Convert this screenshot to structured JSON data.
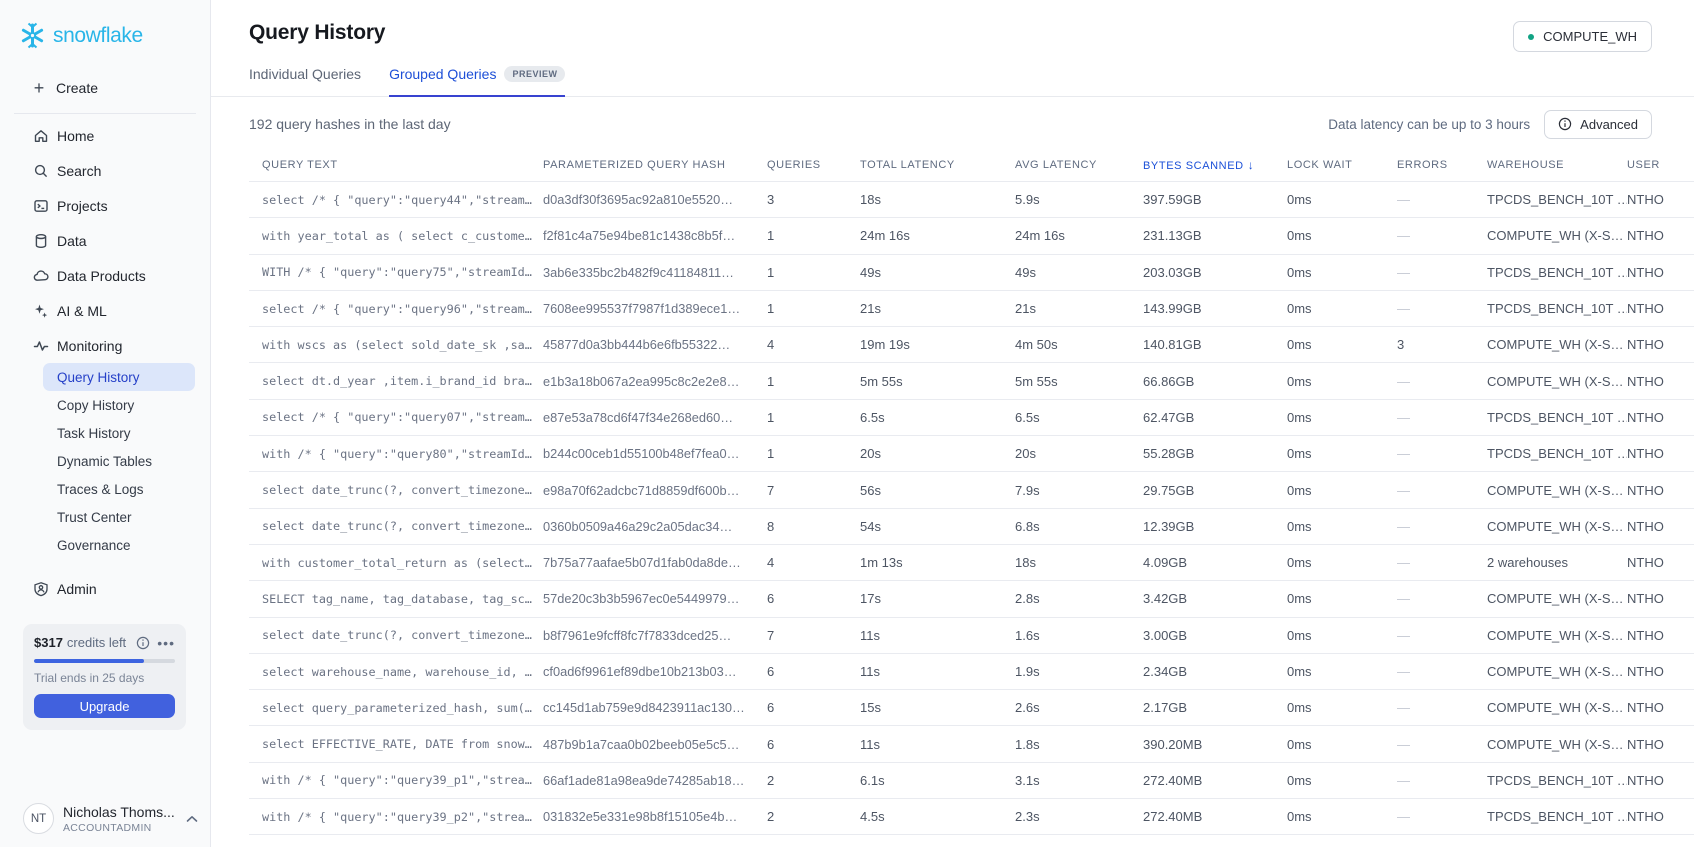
{
  "brand": {
    "name": "snowflake"
  },
  "colors": {
    "logo_blue": "#29b5e8",
    "accent_blue": "#1d4fd7",
    "tab_underline": "#3843d0",
    "selected_item_bg": "#dce6fa",
    "selected_item_text": "#2540c8",
    "upgrade_button": "#4161de",
    "warehouse_status_green": "#11a384",
    "progress_fill": "#3d64e0"
  },
  "sidebar": {
    "create_label": "Create",
    "items": [
      "Home",
      "Search",
      "Projects",
      "Data",
      "Data Products",
      "AI & ML",
      "Monitoring"
    ],
    "monitoring_sub": [
      {
        "label": "Query History",
        "active": true
      },
      {
        "label": "Copy History",
        "active": false
      },
      {
        "label": "Task History",
        "active": false
      },
      {
        "label": "Dynamic Tables",
        "active": false
      },
      {
        "label": "Traces & Logs",
        "active": false
      },
      {
        "label": "Trust Center",
        "active": false
      },
      {
        "label": "Governance",
        "active": false
      }
    ],
    "admin_label": "Admin",
    "trial": {
      "credits": "$317",
      "credits_suffix": "credits left",
      "ends": "Trial ends in 25 days",
      "upgrade_label": "Upgrade",
      "progress_pct": 78
    },
    "user": {
      "initials": "NT",
      "name": "Nicholas Thoms...",
      "role": "ACCOUNTADMIN"
    }
  },
  "header": {
    "title": "Query History",
    "warehouse_button": "COMPUTE_WH",
    "tabs": [
      {
        "label": "Individual Queries",
        "active": false
      },
      {
        "label": "Grouped Queries",
        "active": true,
        "badge": "PREVIEW"
      }
    ],
    "summary": "192 query hashes in the last day",
    "latency_note": "Data latency can be up to 3 hours",
    "advanced_label": "Advanced"
  },
  "table": {
    "columns": [
      {
        "key": "query",
        "label": "QUERY TEXT"
      },
      {
        "key": "hash",
        "label": "PARAMETERIZED QUERY HASH"
      },
      {
        "key": "queries",
        "label": "QUERIES"
      },
      {
        "key": "total",
        "label": "TOTAL LATENCY"
      },
      {
        "key": "avg",
        "label": "AVG LATENCY"
      },
      {
        "key": "bytes",
        "label": "BYTES SCANNED",
        "sorted": "desc"
      },
      {
        "key": "lock",
        "label": "LOCK WAIT"
      },
      {
        "key": "errors",
        "label": "ERRORS"
      },
      {
        "key": "wh",
        "label": "WAREHOUSE"
      },
      {
        "key": "user",
        "label": "USER"
      }
    ],
    "rows": [
      {
        "query": "select /* { \"query\":\"query44\",\"stream…",
        "hash": "d0a3df30f3695ac92a810e5520…",
        "queries": "3",
        "total": "18s",
        "avg": "5.9s",
        "bytes": "397.59GB",
        "lock": "0ms",
        "errors": "—",
        "wh": "TPCDS_BENCH_10T …",
        "user": "NTHO"
      },
      {
        "query": "with year_total as ( select c_custome…",
        "hash": "f2f81c4a75e94be81c1438c8b5f…",
        "queries": "1",
        "total": "24m 16s",
        "avg": "24m 16s",
        "bytes": "231.13GB",
        "lock": "0ms",
        "errors": "—",
        "wh": "COMPUTE_WH (X-S…",
        "user": "NTHO"
      },
      {
        "query": "WITH /* { \"query\":\"query75\",\"streamId…",
        "hash": "3ab6e335bc2b482f9c41184811…",
        "queries": "1",
        "total": "49s",
        "avg": "49s",
        "bytes": "203.03GB",
        "lock": "0ms",
        "errors": "—",
        "wh": "TPCDS_BENCH_10T …",
        "user": "NTHO"
      },
      {
        "query": "select /* { \"query\":\"query96\",\"stream…",
        "hash": "7608ee995537f7987f1d389ece1…",
        "queries": "1",
        "total": "21s",
        "avg": "21s",
        "bytes": "143.99GB",
        "lock": "0ms",
        "errors": "—",
        "wh": "TPCDS_BENCH_10T …",
        "user": "NTHO"
      },
      {
        "query": "with wscs as (select sold_date_sk ,sa…",
        "hash": "45877d0a3bb444b6e6fb55322…",
        "queries": "4",
        "total": "19m 19s",
        "avg": "4m 50s",
        "bytes": "140.81GB",
        "lock": "0ms",
        "errors": "3",
        "wh": "COMPUTE_WH (X-S…",
        "user": "NTHO"
      },
      {
        "query": "select dt.d_year ,item.i_brand_id bra…",
        "hash": "e1b3a18b067a2ea995c8c2e2e8…",
        "queries": "1",
        "total": "5m 55s",
        "avg": "5m 55s",
        "bytes": "66.86GB",
        "lock": "0ms",
        "errors": "—",
        "wh": "COMPUTE_WH (X-S…",
        "user": "NTHO"
      },
      {
        "query": "select /* { \"query\":\"query07\",\"stream…",
        "hash": "e87e53a78cd6f47f34e268ed60…",
        "queries": "1",
        "total": "6.5s",
        "avg": "6.5s",
        "bytes": "62.47GB",
        "lock": "0ms",
        "errors": "—",
        "wh": "TPCDS_BENCH_10T …",
        "user": "NTHO"
      },
      {
        "query": "with /* { \"query\":\"query80\",\"streamId…",
        "hash": "b244c00ceb1d55100b48ef7fea0…",
        "queries": "1",
        "total": "20s",
        "avg": "20s",
        "bytes": "55.28GB",
        "lock": "0ms",
        "errors": "—",
        "wh": "TPCDS_BENCH_10T …",
        "user": "NTHO"
      },
      {
        "query": "select date_trunc(?, convert_timezone…",
        "hash": "e98a70f62adcbc71d8859df600b…",
        "queries": "7",
        "total": "56s",
        "avg": "7.9s",
        "bytes": "29.75GB",
        "lock": "0ms",
        "errors": "—",
        "wh": "COMPUTE_WH (X-S…",
        "user": "NTHO"
      },
      {
        "query": "select date_trunc(?, convert_timezone…",
        "hash": "0360b0509a46a29c2a05dac34…",
        "queries": "8",
        "total": "54s",
        "avg": "6.8s",
        "bytes": "12.39GB",
        "lock": "0ms",
        "errors": "—",
        "wh": "COMPUTE_WH (X-S…",
        "user": "NTHO"
      },
      {
        "query": "with customer_total_return as (select…",
        "hash": "7b75a77aafae5b07d1fab0da8de…",
        "queries": "4",
        "total": "1m 13s",
        "avg": "18s",
        "bytes": "4.09GB",
        "lock": "0ms",
        "errors": "—",
        "wh": "2 warehouses",
        "user": "NTHO"
      },
      {
        "query": "SELECT tag_name, tag_database, tag_sc…",
        "hash": "57de20c3b3b5967ec0e5449979…",
        "queries": "6",
        "total": "17s",
        "avg": "2.8s",
        "bytes": "3.42GB",
        "lock": "0ms",
        "errors": "—",
        "wh": "COMPUTE_WH (X-S…",
        "user": "NTHO"
      },
      {
        "query": "select date_trunc(?, convert_timezone…",
        "hash": "b8f7961e9fcff8fc7f7833dced25…",
        "queries": "7",
        "total": "11s",
        "avg": "1.6s",
        "bytes": "3.00GB",
        "lock": "0ms",
        "errors": "—",
        "wh": "COMPUTE_WH (X-S…",
        "user": "NTHO"
      },
      {
        "query": "select warehouse_name, warehouse_id, …",
        "hash": "cf0ad6f9961ef89dbe10b213b03…",
        "queries": "6",
        "total": "11s",
        "avg": "1.9s",
        "bytes": "2.34GB",
        "lock": "0ms",
        "errors": "—",
        "wh": "COMPUTE_WH (X-S…",
        "user": "NTHO"
      },
      {
        "query": "select query_parameterized_hash, sum(…",
        "hash": "cc145d1ab759e9d8423911ac130…",
        "queries": "6",
        "total": "15s",
        "avg": "2.6s",
        "bytes": "2.17GB",
        "lock": "0ms",
        "errors": "—",
        "wh": "COMPUTE_WH (X-S…",
        "user": "NTHO"
      },
      {
        "query": "select EFFECTIVE_RATE, DATE from snow…",
        "hash": "487b9b1a7caa0b02beeb05e5c5…",
        "queries": "6",
        "total": "11s",
        "avg": "1.8s",
        "bytes": "390.20MB",
        "lock": "0ms",
        "errors": "—",
        "wh": "COMPUTE_WH (X-S…",
        "user": "NTHO"
      },
      {
        "query": "with /* { \"query\":\"query39_p1\",\"strea…",
        "hash": "66af1ade81a98ea9de74285ab18…",
        "queries": "2",
        "total": "6.1s",
        "avg": "3.1s",
        "bytes": "272.40MB",
        "lock": "0ms",
        "errors": "—",
        "wh": "TPCDS_BENCH_10T …",
        "user": "NTHO"
      },
      {
        "query": "with /* { \"query\":\"query39_p2\",\"strea…",
        "hash": "031832e5e331e98b8f15105e4b…",
        "queries": "2",
        "total": "4.5s",
        "avg": "2.3s",
        "bytes": "272.40MB",
        "lock": "0ms",
        "errors": "—",
        "wh": "TPCDS_BENCH_10T …",
        "user": "NTHO"
      }
    ]
  }
}
